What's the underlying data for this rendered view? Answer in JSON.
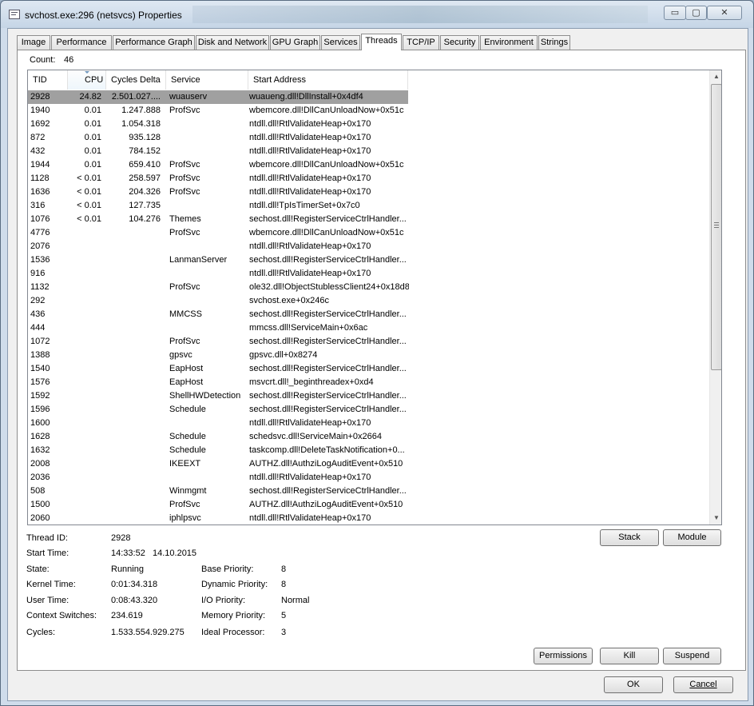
{
  "window": {
    "title": "svchost.exe:296 (netsvcs) Properties",
    "minimize_glyph": "▭",
    "maximize_glyph": "▢",
    "close_glyph": "✕"
  },
  "tabs": [
    {
      "label": "Image"
    },
    {
      "label": "Performance"
    },
    {
      "label": "Performance Graph"
    },
    {
      "label": "Disk and Network"
    },
    {
      "label": "GPU Graph"
    },
    {
      "label": "Services"
    },
    {
      "label": "Threads"
    },
    {
      "label": "TCP/IP"
    },
    {
      "label": "Security"
    },
    {
      "label": "Environment"
    },
    {
      "label": "Strings"
    }
  ],
  "active_tab": "Threads",
  "count": {
    "label": "Count:",
    "value": "46"
  },
  "table": {
    "columns": {
      "tid": "TID",
      "cpu": "CPU",
      "cycles": "Cycles Delta",
      "service": "Service",
      "address": "Start Address"
    },
    "sorted_column": "CPU",
    "selected_tid": "2928",
    "rows": [
      {
        "tid": "2928",
        "cpu": "24.82",
        "cycles": "2.501.027....",
        "service": "wuauserv",
        "address": "wuaueng.dll!DllInstall+0x4df4"
      },
      {
        "tid": "1940",
        "cpu": "0.01",
        "cycles": "1.247.888",
        "service": "ProfSvc",
        "address": "wbemcore.dll!DllCanUnloadNow+0x51c"
      },
      {
        "tid": "1692",
        "cpu": "0.01",
        "cycles": "1.054.318",
        "service": "",
        "address": "ntdll.dll!RtlValidateHeap+0x170"
      },
      {
        "tid": "872",
        "cpu": "0.01",
        "cycles": "935.128",
        "service": "",
        "address": "ntdll.dll!RtlValidateHeap+0x170"
      },
      {
        "tid": "432",
        "cpu": "0.01",
        "cycles": "784.152",
        "service": "",
        "address": "ntdll.dll!RtlValidateHeap+0x170"
      },
      {
        "tid": "1944",
        "cpu": "0.01",
        "cycles": "659.410",
        "service": "ProfSvc",
        "address": "wbemcore.dll!DllCanUnloadNow+0x51c"
      },
      {
        "tid": "1128",
        "cpu": "< 0.01",
        "cycles": "258.597",
        "service": "ProfSvc",
        "address": "ntdll.dll!RtlValidateHeap+0x170"
      },
      {
        "tid": "1636",
        "cpu": "< 0.01",
        "cycles": "204.326",
        "service": "ProfSvc",
        "address": "ntdll.dll!RtlValidateHeap+0x170"
      },
      {
        "tid": "316",
        "cpu": "< 0.01",
        "cycles": "127.735",
        "service": "",
        "address": "ntdll.dll!TpIsTimerSet+0x7c0"
      },
      {
        "tid": "1076",
        "cpu": "< 0.01",
        "cycles": "104.276",
        "service": "Themes",
        "address": "sechost.dll!RegisterServiceCtrlHandler..."
      },
      {
        "tid": "4776",
        "cpu": "",
        "cycles": "",
        "service": "ProfSvc",
        "address": "wbemcore.dll!DllCanUnloadNow+0x51c"
      },
      {
        "tid": "2076",
        "cpu": "",
        "cycles": "",
        "service": "",
        "address": "ntdll.dll!RtlValidateHeap+0x170"
      },
      {
        "tid": "1536",
        "cpu": "",
        "cycles": "",
        "service": "LanmanServer",
        "address": "sechost.dll!RegisterServiceCtrlHandler..."
      },
      {
        "tid": "916",
        "cpu": "",
        "cycles": "",
        "service": "",
        "address": "ntdll.dll!RtlValidateHeap+0x170"
      },
      {
        "tid": "1132",
        "cpu": "",
        "cycles": "",
        "service": "ProfSvc",
        "address": "ole32.dll!ObjectStublessClient24+0x18d8"
      },
      {
        "tid": "292",
        "cpu": "",
        "cycles": "",
        "service": "",
        "address": "svchost.exe+0x246c"
      },
      {
        "tid": "436",
        "cpu": "",
        "cycles": "",
        "service": "MMCSS",
        "address": "sechost.dll!RegisterServiceCtrlHandler..."
      },
      {
        "tid": "444",
        "cpu": "",
        "cycles": "",
        "service": "",
        "address": "mmcss.dll!ServiceMain+0x6ac"
      },
      {
        "tid": "1072",
        "cpu": "",
        "cycles": "",
        "service": "ProfSvc",
        "address": "sechost.dll!RegisterServiceCtrlHandler..."
      },
      {
        "tid": "1388",
        "cpu": "",
        "cycles": "",
        "service": "gpsvc",
        "address": "gpsvc.dll+0x8274"
      },
      {
        "tid": "1540",
        "cpu": "",
        "cycles": "",
        "service": "EapHost",
        "address": "sechost.dll!RegisterServiceCtrlHandler..."
      },
      {
        "tid": "1576",
        "cpu": "",
        "cycles": "",
        "service": "EapHost",
        "address": "msvcrt.dll!_beginthreadex+0xd4"
      },
      {
        "tid": "1592",
        "cpu": "",
        "cycles": "",
        "service": "ShellHWDetection",
        "address": "sechost.dll!RegisterServiceCtrlHandler..."
      },
      {
        "tid": "1596",
        "cpu": "",
        "cycles": "",
        "service": "Schedule",
        "address": "sechost.dll!RegisterServiceCtrlHandler..."
      },
      {
        "tid": "1600",
        "cpu": "",
        "cycles": "",
        "service": "",
        "address": "ntdll.dll!RtlValidateHeap+0x170"
      },
      {
        "tid": "1628",
        "cpu": "",
        "cycles": "",
        "service": "Schedule",
        "address": "schedsvc.dll!ServiceMain+0x2664"
      },
      {
        "tid": "1632",
        "cpu": "",
        "cycles": "",
        "service": "Schedule",
        "address": "taskcomp.dll!DeleteTaskNotification+0..."
      },
      {
        "tid": "2008",
        "cpu": "",
        "cycles": "",
        "service": "IKEEXT",
        "address": "AUTHZ.dll!AuthziLogAuditEvent+0x510"
      },
      {
        "tid": "2036",
        "cpu": "",
        "cycles": "",
        "service": "",
        "address": "ntdll.dll!RtlValidateHeap+0x170"
      },
      {
        "tid": "508",
        "cpu": "",
        "cycles": "",
        "service": "Winmgmt",
        "address": "sechost.dll!RegisterServiceCtrlHandler..."
      },
      {
        "tid": "1500",
        "cpu": "",
        "cycles": "",
        "service": "ProfSvc",
        "address": "AUTHZ.dll!AuthziLogAuditEvent+0x510"
      },
      {
        "tid": "2060",
        "cpu": "",
        "cycles": "",
        "service": "iphlpsvc",
        "address": "ntdll.dll!RtlValidateHeap+0x170"
      }
    ]
  },
  "details": {
    "thread_id": {
      "label": "Thread ID:",
      "value": "2928"
    },
    "start_time": {
      "label": "Start Time:",
      "value": "14:33:52   14.10.2015"
    },
    "state": {
      "label": "State:",
      "value": "Running"
    },
    "kernel_time": {
      "label": "Kernel Time:",
      "value": "0:01:34.318"
    },
    "user_time": {
      "label": "User Time:",
      "value": "0:08:43.320"
    },
    "context_switches": {
      "label": "Context Switches:",
      "value": "234.619"
    },
    "cycles": {
      "label": "Cycles:",
      "value": "1.533.554.929.275"
    },
    "base_priority": {
      "label": "Base Priority:",
      "value": "8"
    },
    "dynamic_priority": {
      "label": "Dynamic Priority:",
      "value": "8"
    },
    "io_priority": {
      "label": "I/O Priority:",
      "value": "Normal"
    },
    "memory_priority": {
      "label": "Memory Priority:",
      "value": "5"
    },
    "ideal_processor": {
      "label": "Ideal Processor:",
      "value": "3"
    }
  },
  "buttons": {
    "stack": "Stack",
    "module": "Module",
    "permissions": "Permissions",
    "kill": "Kill",
    "suspend": "Suspend",
    "ok": "OK",
    "cancel": "Cancel"
  },
  "scrollbar": {
    "up_glyph": "▲",
    "down_glyph": "▼"
  },
  "colors": {
    "selection": "#a0a0a0",
    "window_frame": "#cfdceb",
    "panel": "#ffffff"
  }
}
